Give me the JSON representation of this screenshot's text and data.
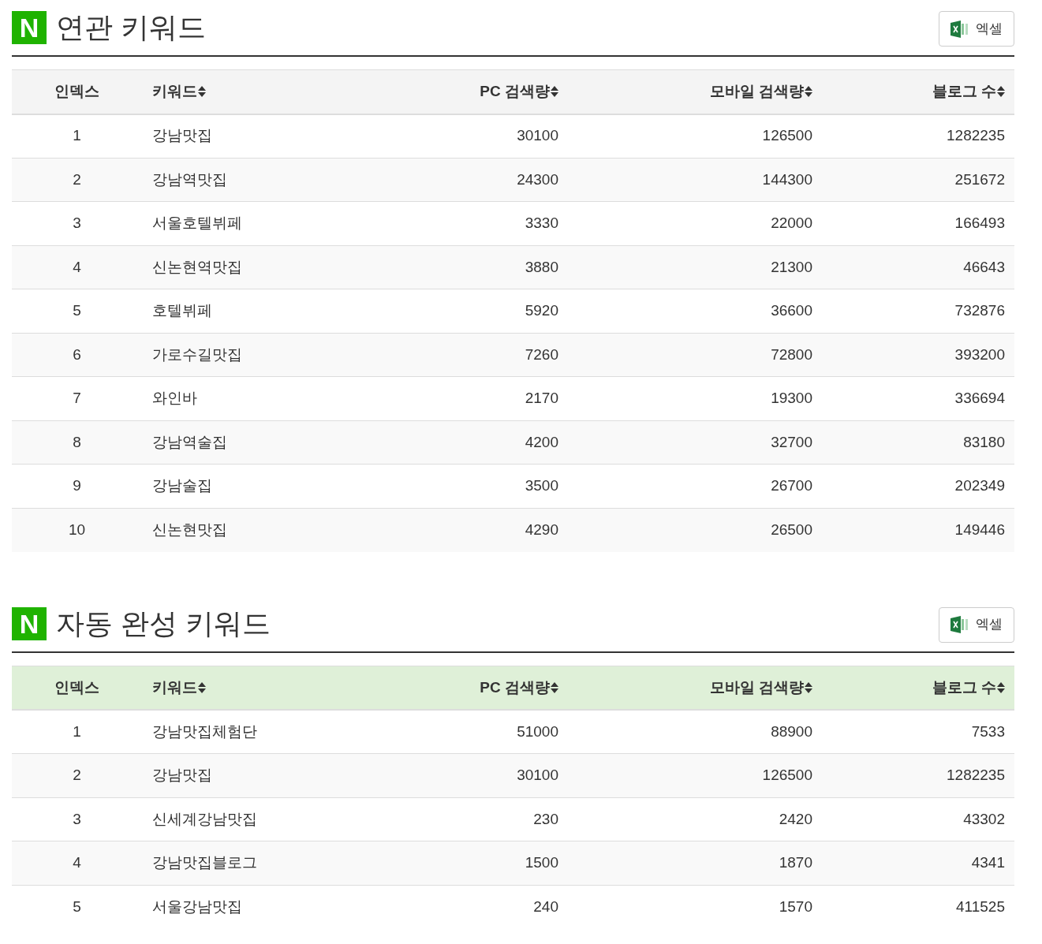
{
  "sections": [
    {
      "logo": "N",
      "title": "연관 키워드",
      "excel_button": "엑셀",
      "header_highlighted": false,
      "columns": [
        {
          "label": "인덱스",
          "sortable": false
        },
        {
          "label": "키워드",
          "sortable": true
        },
        {
          "label": "PC 검색량",
          "sortable": true
        },
        {
          "label": "모바일 검색량",
          "sortable": true
        },
        {
          "label": "블로그 수",
          "sortable": true
        }
      ],
      "rows": [
        [
          "1",
          "강남맛집",
          "30100",
          "126500",
          "1282235"
        ],
        [
          "2",
          "강남역맛집",
          "24300",
          "144300",
          "251672"
        ],
        [
          "3",
          "서울호텔뷔페",
          "3330",
          "22000",
          "166493"
        ],
        [
          "4",
          "신논현역맛집",
          "3880",
          "21300",
          "46643"
        ],
        [
          "5",
          "호텔뷔페",
          "5920",
          "36600",
          "732876"
        ],
        [
          "6",
          "가로수길맛집",
          "7260",
          "72800",
          "393200"
        ],
        [
          "7",
          "와인바",
          "2170",
          "19300",
          "336694"
        ],
        [
          "8",
          "강남역술집",
          "4200",
          "32700",
          "83180"
        ],
        [
          "9",
          "강남술집",
          "3500",
          "26700",
          "202349"
        ],
        [
          "10",
          "신논현맛집",
          "4290",
          "26500",
          "149446"
        ]
      ]
    },
    {
      "logo": "N",
      "title": "자동 완성 키워드",
      "excel_button": "엑셀",
      "header_highlighted": true,
      "columns": [
        {
          "label": "인덱스",
          "sortable": false
        },
        {
          "label": "키워드",
          "sortable": true
        },
        {
          "label": "PC 검색량",
          "sortable": true
        },
        {
          "label": "모바일 검색량",
          "sortable": true
        },
        {
          "label": "블로그 수",
          "sortable": true
        }
      ],
      "rows": [
        [
          "1",
          "강남맛집체험단",
          "51000",
          "88900",
          "7533"
        ],
        [
          "2",
          "강남맛집",
          "30100",
          "126500",
          "1282235"
        ],
        [
          "3",
          "신세계강남맛집",
          "230",
          "2420",
          "43302"
        ],
        [
          "4",
          "강남맛집블로그",
          "1500",
          "1870",
          "4341"
        ],
        [
          "5",
          "서울강남맛집",
          "240",
          "1570",
          "411525"
        ]
      ]
    }
  ]
}
